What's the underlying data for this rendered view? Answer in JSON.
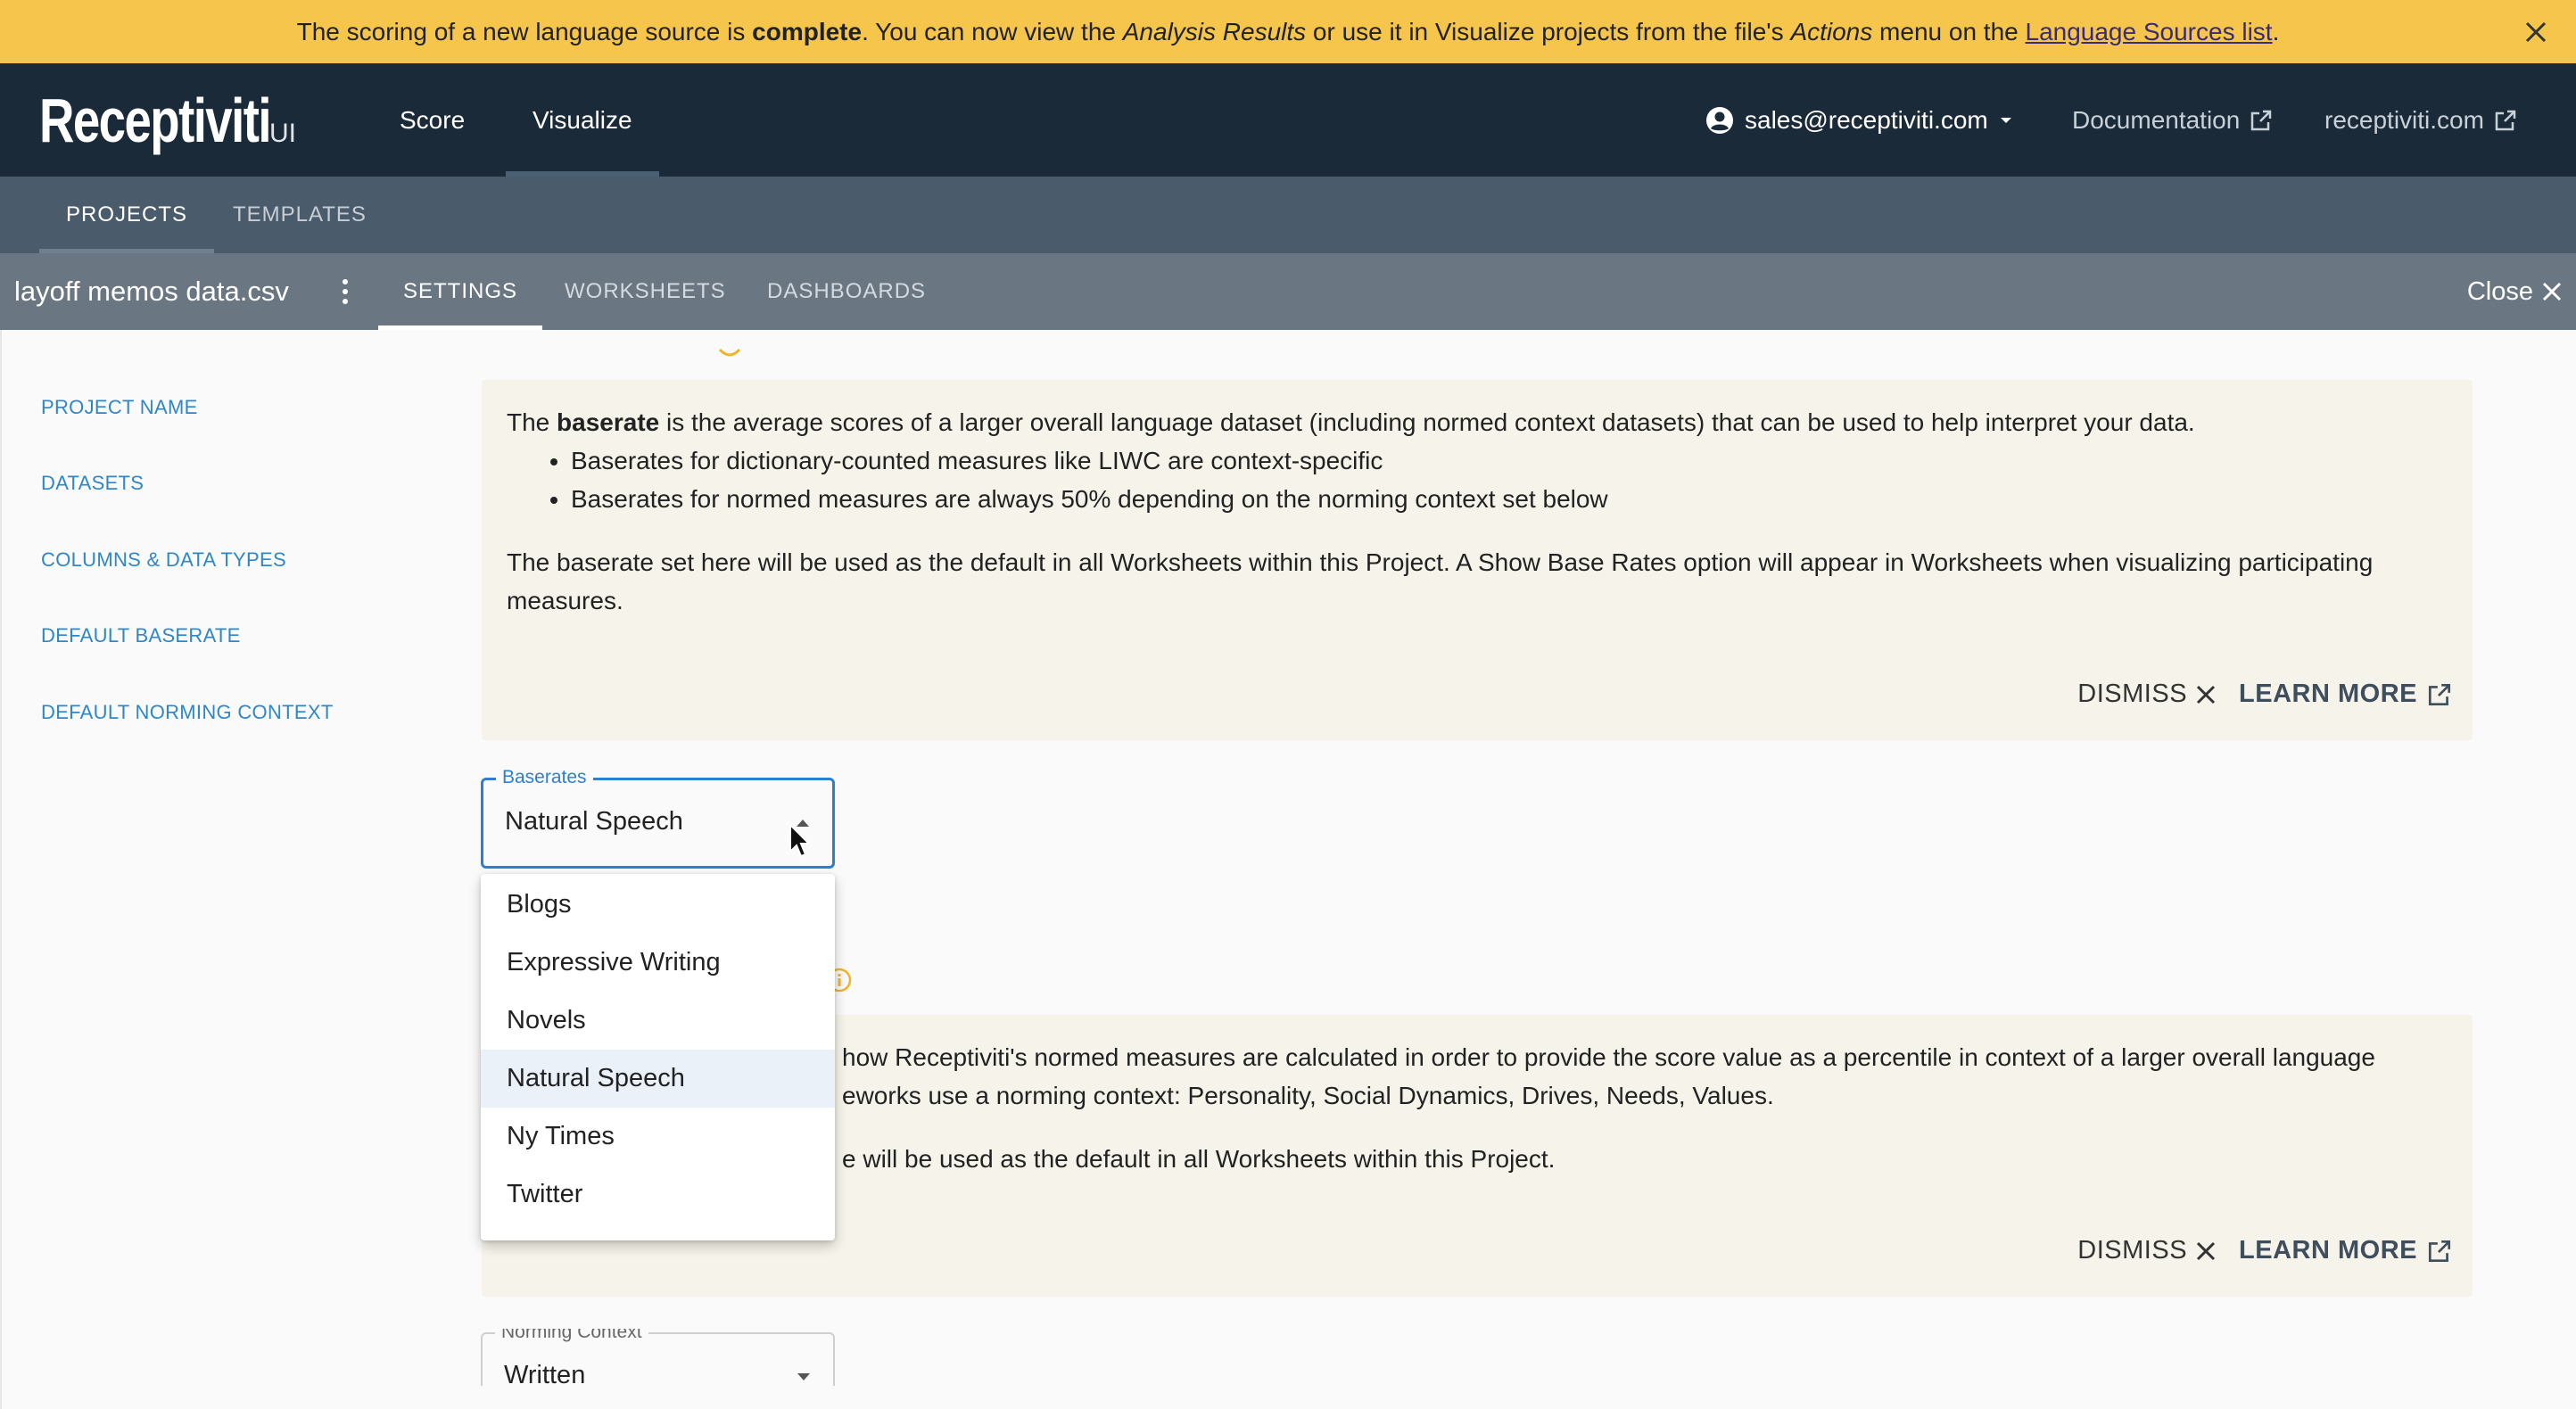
{
  "banner": {
    "text_1": "The scoring of a new language source is ",
    "bold": "complete",
    "text_2": ". You can now view the ",
    "italic_1": "Analysis Results",
    "text_3": " or use it in Visualize projects from the file's ",
    "italic_2": "Actions",
    "text_4": " menu on the ",
    "link": "Language Sources list",
    "text_5": "."
  },
  "header": {
    "brand": "Receptiviti",
    "brand_suffix": "UI",
    "tabs": [
      {
        "label": "Score"
      },
      {
        "label": "Visualize",
        "active": true
      }
    ],
    "account": "sales@receptiviti.com",
    "documentation": "Documentation",
    "site": "receptiviti.com"
  },
  "subnav": {
    "tabs": [
      {
        "label": "PROJECTS",
        "active": true
      },
      {
        "label": "TEMPLATES"
      }
    ]
  },
  "project": {
    "name": "layoff memos data.csv",
    "tabs": [
      {
        "label": "SETTINGS",
        "active": true
      },
      {
        "label": "WORKSHEETS"
      },
      {
        "label": "DASHBOARDS"
      }
    ],
    "close_label": "Close"
  },
  "sidebar": {
    "items": [
      {
        "label": "PROJECT NAME"
      },
      {
        "label": "DATASETS"
      },
      {
        "label": "COLUMNS & DATA TYPES"
      },
      {
        "label": "DEFAULT BASERATE"
      },
      {
        "label": "DEFAULT NORMING CONTEXT"
      }
    ]
  },
  "baserate_info": {
    "line1_pre": "The ",
    "line1_bold": "baserate",
    "line1_post": " is the average scores of a larger overall language dataset (including normed context datasets) that can be used to help interpret your data.",
    "bullets": [
      "Baserates for dictionary-counted measures like LIWC are context-specific",
      "Baserates for normed measures are always 50% depending on the norming context set below"
    ],
    "paragraph": "The baserate set here will be used as the default in all Worksheets within this Project. A Show Base Rates option will appear in Worksheets when visualizing participating measures.",
    "dismiss": "DISMISS",
    "learn_more": "LEARN MORE"
  },
  "baserates_select": {
    "label": "Baserates",
    "value": "Natural Speech",
    "options": [
      "Blogs",
      "Expressive Writing",
      "Novels",
      "Natural Speech",
      "Ny Times",
      "Twitter"
    ]
  },
  "norming_info": {
    "line1": "how Receptiviti's normed measures are calculated in order to provide the score value as a percentile in context of a larger overall language",
    "line2": "eworks use a norming context: Personality, Social Dynamics, Drives, Needs, Values.",
    "line3": "e will be used as the default in all Worksheets within this Project.",
    "dismiss": "DISMISS",
    "learn_more": "LEARN MORE"
  },
  "norming_select": {
    "label": "Norming Context",
    "value": "Written"
  },
  "colors": {
    "banner": "#f5c64b",
    "topnav": "#1b2a38",
    "subnav": "#4a5b6b",
    "projbar": "#6a7783",
    "link": "#2f87c8",
    "info_bg": "#f6f4ea",
    "focus": "#2f7fd0"
  },
  "icons": [
    "close-icon",
    "account-icon",
    "caret-down-icon",
    "external-link-icon",
    "kebab-icon",
    "x-icon",
    "arrow-up-icon",
    "arrow-down-icon",
    "info-icon",
    "cursor-icon"
  ]
}
